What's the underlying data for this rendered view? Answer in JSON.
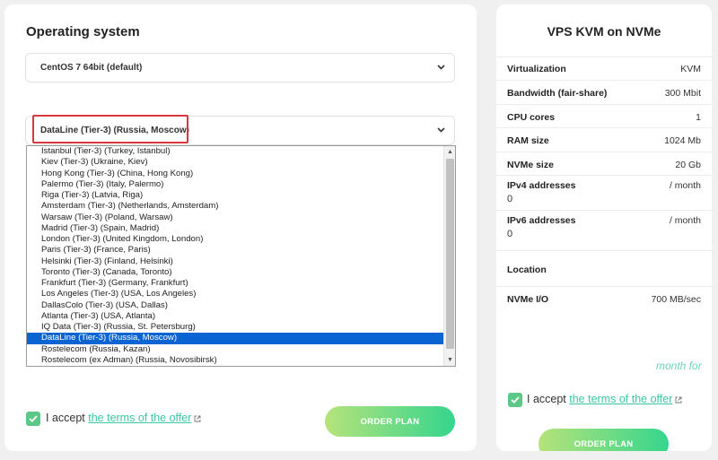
{
  "left_panel": {
    "title": "Operating system",
    "os_select": {
      "value": "CentOS 7 64bit (default)"
    },
    "location_select": {
      "value": "DataLine (Tier-3) (Russia, Moscow)",
      "options": [
        "Istanbul (Tier-3) (Turkey, Istanbul)",
        "Kiev (Tier-3) (Ukraine, Kiev)",
        "Hong Kong (Tier-3) (China, Hong Kong)",
        "Palermo (Tier-3) (Italy, Palermo)",
        "Riga (Tier-3) (Latvia, Riga)",
        "Amsterdam (Tier-3) (Netherlands, Amsterdam)",
        "Warsaw (Tier-3) (Poland, Warsaw)",
        "Madrid (Tier-3) (Spain, Madrid)",
        "London (Tier-3) (United Kingdom, London)",
        "Paris (Tier-3) (France, Paris)",
        "Helsinki (Tier-3) (Finland, Helsinki)",
        "Toronto (Tier-3) (Canada, Toronto)",
        "Frankfurt (Tier-3) (Germany, Frankfurt)",
        "Los Angeles (Tier-3) (USA, Los Angeles)",
        "DallasColo (Tier-3) (USA, Dallas)",
        "Atlanta (Tier-3) (USA, Atlanta)",
        "IQ Data (Tier-3) (Russia, St. Petersburg)",
        "DataLine (Tier-3) (Russia, Moscow)",
        "Rostelecom (Russia, Kazan)",
        "Rostelecom (ex Adman) (Russia, Novosibirsk)"
      ],
      "selected_index": 17
    },
    "accept": {
      "prefix": "I accept ",
      "link": "the terms of the offer"
    },
    "order_button": "ORDER PLAN"
  },
  "right_panel": {
    "title": "VPS KVM on NVMe",
    "specs": {
      "virtualization": {
        "label": "Virtualization",
        "value": "KVM"
      },
      "bandwidth": {
        "label": "Bandwidth (fair-share)",
        "value": "300 Mbit"
      },
      "cpu": {
        "label": "CPU cores",
        "value": "1"
      },
      "ram": {
        "label": "RAM size",
        "value": "1024 Mb"
      },
      "nvme": {
        "label": "NVMe size",
        "value": "20 Gb"
      },
      "ipv4": {
        "label": "IPv4 addresses",
        "value": "/ month",
        "count": "0"
      },
      "ipv6": {
        "label": "IPv6 addresses",
        "value": "/ month",
        "count": "0"
      },
      "location": {
        "label": "Location",
        "value": ""
      },
      "nvme_io": {
        "label": "NVMe I/O",
        "value": "700 MB/sec"
      }
    },
    "month_for": "month for",
    "accept": {
      "prefix": "I accept ",
      "link": "the terms of the offer"
    },
    "order_button": "ORDER PLAN"
  },
  "colors": {
    "accent_green": "#5cc787",
    "link": "#3cc7a4",
    "selected_option": "#0a64d1",
    "highlight_border": "#d9363e"
  }
}
